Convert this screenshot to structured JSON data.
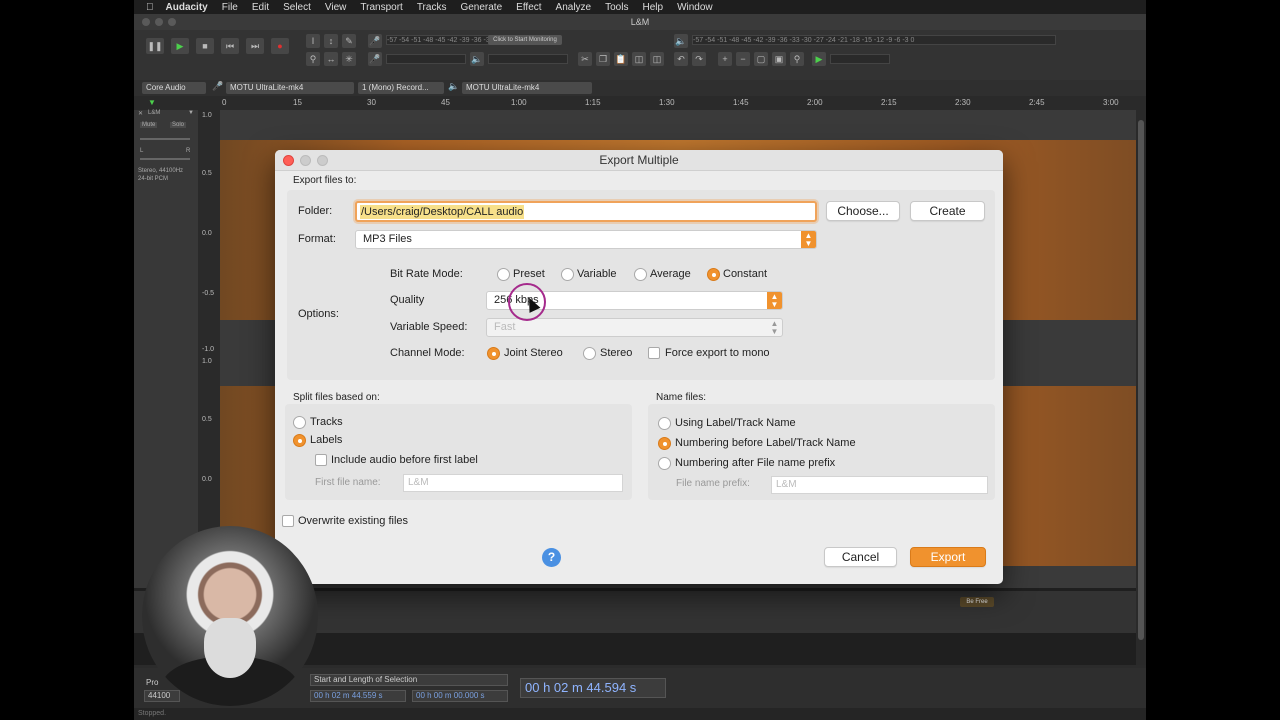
{
  "menubar": {
    "app_name": "Audacity",
    "items": [
      "File",
      "Edit",
      "Select",
      "View",
      "Transport",
      "Tracks",
      "Generate",
      "Effect",
      "Analyze",
      "Tools",
      "Help",
      "Window"
    ]
  },
  "window": {
    "title": "L&M"
  },
  "toolbar": {
    "monitor_label": "Click to Start Monitoring",
    "meter_ticks": "-57 -54 -51 -48 -45 -42 -39 -36 -33 -30 -27 -24 -21 -18 -15 -12 -9 -6 -3 0"
  },
  "devices": {
    "host": "Core Audio",
    "input_device": "MOTU UltraLite-mk4",
    "channels": "1 (Mono) Record...",
    "output_device": "MOTU UltraLite-mk4"
  },
  "ruler": {
    "ticks": [
      "0",
      "15",
      "30",
      "45",
      "1:00",
      "1:15",
      "1:30",
      "1:45",
      "2:00",
      "2:15",
      "2:30",
      "2:45",
      "3:00"
    ]
  },
  "track": {
    "name": "L&M",
    "mute": "Mute",
    "solo": "Solo",
    "left": "L",
    "right": "R",
    "info": "Stereo, 44100Hz",
    "format": "24-bit PCM",
    "scale": [
      "1.0",
      "0.5",
      "0.0",
      "-0.5",
      "-1.0",
      "1.0",
      "0.5",
      "0.0"
    ]
  },
  "label_track": {
    "label": "Be Free"
  },
  "selection_bar": {
    "project_rate_label": "Pro",
    "project_rate": "44100",
    "mode": "Start and Length of Selection",
    "start": "00 h 02 m 44.559 s",
    "length": "00 h 00 m 00.000 s",
    "position": "00 h 02 m 44.594 s"
  },
  "status": {
    "text": "Stopped."
  },
  "dialog": {
    "title": "Export Multiple",
    "export_to_label": "Export files to:",
    "folder_label": "Folder:",
    "folder_value": "/Users/craig/Desktop/CALL audio",
    "choose_button": "Choose...",
    "create_button": "Create",
    "format_label": "Format:",
    "format_value": "MP3 Files",
    "options_label": "Options:",
    "bitrate_mode_label": "Bit Rate Mode:",
    "bitrate_modes": [
      "Preset",
      "Variable",
      "Average",
      "Constant"
    ],
    "quality_label": "Quality",
    "quality_value": "256 kbps",
    "variable_speed_label": "Variable Speed:",
    "variable_speed_value": "Fast",
    "channel_mode_label": "Channel Mode:",
    "channel_modes": [
      "Joint Stereo",
      "Stereo"
    ],
    "force_mono_label": "Force export to mono",
    "split_label": "Split files based on:",
    "split_tracks": "Tracks",
    "split_labels": "Labels",
    "include_audio_label": "Include audio before first label",
    "first_file_name_label": "First file name:",
    "first_file_name_value": "L&M",
    "name_files_label": "Name files:",
    "name_using_label": "Using Label/Track Name",
    "name_numbering_before": "Numbering before Label/Track Name",
    "name_numbering_after": "Numbering after File name prefix",
    "file_name_prefix_label": "File name prefix:",
    "file_name_prefix_value": "L&M",
    "overwrite_label": "Overwrite existing files",
    "help_glyph": "?",
    "cancel_button": "Cancel",
    "export_button": "Export"
  },
  "colors": {
    "accent": "#f0922e",
    "waveform": "#d9832d",
    "help": "#4a90e2"
  }
}
